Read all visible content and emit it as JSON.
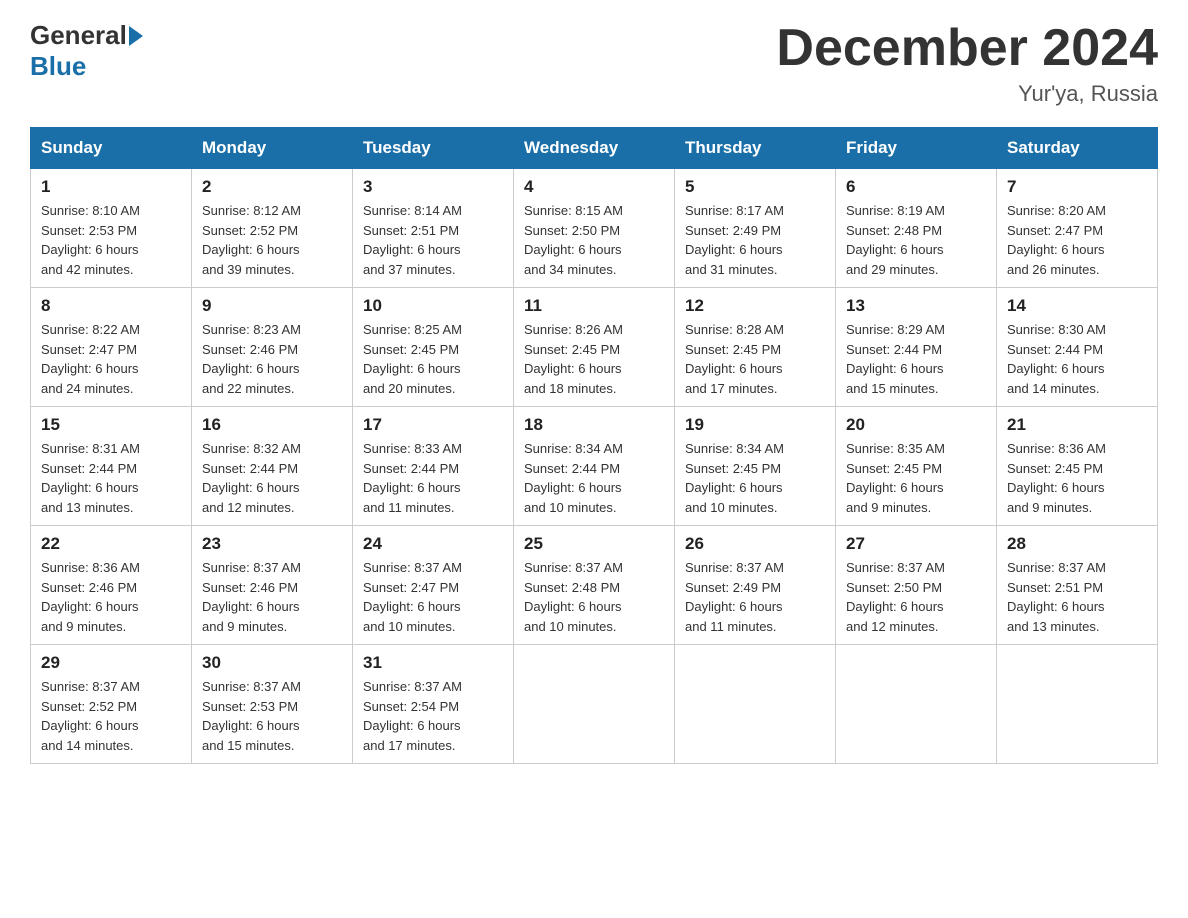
{
  "header": {
    "logo_general": "General",
    "logo_blue": "Blue",
    "title": "December 2024",
    "location": "Yur'ya, Russia"
  },
  "days_of_week": [
    "Sunday",
    "Monday",
    "Tuesday",
    "Wednesday",
    "Thursday",
    "Friday",
    "Saturday"
  ],
  "weeks": [
    [
      {
        "day": "1",
        "sunrise": "8:10 AM",
        "sunset": "2:53 PM",
        "daylight": "6 hours and 42 minutes."
      },
      {
        "day": "2",
        "sunrise": "8:12 AM",
        "sunset": "2:52 PM",
        "daylight": "6 hours and 39 minutes."
      },
      {
        "day": "3",
        "sunrise": "8:14 AM",
        "sunset": "2:51 PM",
        "daylight": "6 hours and 37 minutes."
      },
      {
        "day": "4",
        "sunrise": "8:15 AM",
        "sunset": "2:50 PM",
        "daylight": "6 hours and 34 minutes."
      },
      {
        "day": "5",
        "sunrise": "8:17 AM",
        "sunset": "2:49 PM",
        "daylight": "6 hours and 31 minutes."
      },
      {
        "day": "6",
        "sunrise": "8:19 AM",
        "sunset": "2:48 PM",
        "daylight": "6 hours and 29 minutes."
      },
      {
        "day": "7",
        "sunrise": "8:20 AM",
        "sunset": "2:47 PM",
        "daylight": "6 hours and 26 minutes."
      }
    ],
    [
      {
        "day": "8",
        "sunrise": "8:22 AM",
        "sunset": "2:47 PM",
        "daylight": "6 hours and 24 minutes."
      },
      {
        "day": "9",
        "sunrise": "8:23 AM",
        "sunset": "2:46 PM",
        "daylight": "6 hours and 22 minutes."
      },
      {
        "day": "10",
        "sunrise": "8:25 AM",
        "sunset": "2:45 PM",
        "daylight": "6 hours and 20 minutes."
      },
      {
        "day": "11",
        "sunrise": "8:26 AM",
        "sunset": "2:45 PM",
        "daylight": "6 hours and 18 minutes."
      },
      {
        "day": "12",
        "sunrise": "8:28 AM",
        "sunset": "2:45 PM",
        "daylight": "6 hours and 17 minutes."
      },
      {
        "day": "13",
        "sunrise": "8:29 AM",
        "sunset": "2:44 PM",
        "daylight": "6 hours and 15 minutes."
      },
      {
        "day": "14",
        "sunrise": "8:30 AM",
        "sunset": "2:44 PM",
        "daylight": "6 hours and 14 minutes."
      }
    ],
    [
      {
        "day": "15",
        "sunrise": "8:31 AM",
        "sunset": "2:44 PM",
        "daylight": "6 hours and 13 minutes."
      },
      {
        "day": "16",
        "sunrise": "8:32 AM",
        "sunset": "2:44 PM",
        "daylight": "6 hours and 12 minutes."
      },
      {
        "day": "17",
        "sunrise": "8:33 AM",
        "sunset": "2:44 PM",
        "daylight": "6 hours and 11 minutes."
      },
      {
        "day": "18",
        "sunrise": "8:34 AM",
        "sunset": "2:44 PM",
        "daylight": "6 hours and 10 minutes."
      },
      {
        "day": "19",
        "sunrise": "8:34 AM",
        "sunset": "2:45 PM",
        "daylight": "6 hours and 10 minutes."
      },
      {
        "day": "20",
        "sunrise": "8:35 AM",
        "sunset": "2:45 PM",
        "daylight": "6 hours and 9 minutes."
      },
      {
        "day": "21",
        "sunrise": "8:36 AM",
        "sunset": "2:45 PM",
        "daylight": "6 hours and 9 minutes."
      }
    ],
    [
      {
        "day": "22",
        "sunrise": "8:36 AM",
        "sunset": "2:46 PM",
        "daylight": "6 hours and 9 minutes."
      },
      {
        "day": "23",
        "sunrise": "8:37 AM",
        "sunset": "2:46 PM",
        "daylight": "6 hours and 9 minutes."
      },
      {
        "day": "24",
        "sunrise": "8:37 AM",
        "sunset": "2:47 PM",
        "daylight": "6 hours and 10 minutes."
      },
      {
        "day": "25",
        "sunrise": "8:37 AM",
        "sunset": "2:48 PM",
        "daylight": "6 hours and 10 minutes."
      },
      {
        "day": "26",
        "sunrise": "8:37 AM",
        "sunset": "2:49 PM",
        "daylight": "6 hours and 11 minutes."
      },
      {
        "day": "27",
        "sunrise": "8:37 AM",
        "sunset": "2:50 PM",
        "daylight": "6 hours and 12 minutes."
      },
      {
        "day": "28",
        "sunrise": "8:37 AM",
        "sunset": "2:51 PM",
        "daylight": "6 hours and 13 minutes."
      }
    ],
    [
      {
        "day": "29",
        "sunrise": "8:37 AM",
        "sunset": "2:52 PM",
        "daylight": "6 hours and 14 minutes."
      },
      {
        "day": "30",
        "sunrise": "8:37 AM",
        "sunset": "2:53 PM",
        "daylight": "6 hours and 15 minutes."
      },
      {
        "day": "31",
        "sunrise": "8:37 AM",
        "sunset": "2:54 PM",
        "daylight": "6 hours and 17 minutes."
      },
      null,
      null,
      null,
      null
    ]
  ],
  "labels": {
    "sunrise": "Sunrise:",
    "sunset": "Sunset:",
    "daylight": "Daylight:"
  }
}
